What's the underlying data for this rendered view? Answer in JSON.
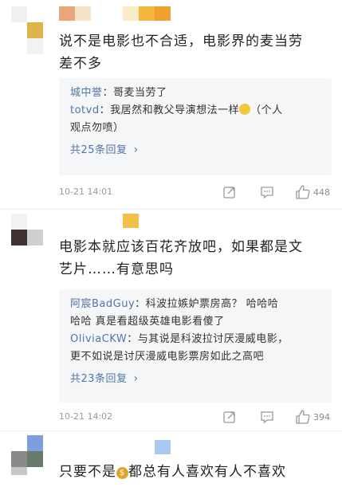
{
  "comments": [
    {
      "text_line1": "说不是电影也不合适，电影界的麦当劳",
      "text_line2": "差不多",
      "replies": [
        {
          "user": "城中誉",
          "text": "：哥麦当劳了"
        },
        {
          "user": "totvd",
          "text": "：我居然和教父导演想法一样",
          "text_after": "（个人",
          "text_line2": "观点勿喷）"
        }
      ],
      "more": "共25条回复",
      "time": "10-21 14:01",
      "likes": "448"
    },
    {
      "text_line1": "电影本就应该百花齐放吧，如果都是文",
      "text_line2": "艺片……有意思吗",
      "replies": [
        {
          "user": "阿宸BadGuy",
          "text": "：科波拉嫉妒票房高？ 哈哈哈",
          "text_line2": "哈哈 真是看超级英雄电影看傻了"
        },
        {
          "user": "OliviaCKW",
          "text": "：与其说是科波拉讨厌漫威电影，",
          "text_line2": "更不如说是讨厌漫威电影票房如此之高吧"
        }
      ],
      "more": "共23条回复",
      "time": "10-21 14:02",
      "likes": "394"
    },
    {
      "text_before": "只要不是",
      "emoji": "$",
      "text_after": "都总有人喜欢有人不喜欢"
    }
  ],
  "colors": {
    "link": "#5176a8",
    "reply_bg": "#f5f6f8",
    "meta_gray": "#999999"
  },
  "icons": {
    "share": "share-icon",
    "comment": "comment-icon",
    "like": "thumbs-up-icon",
    "more": "chevron-right-icon"
  }
}
